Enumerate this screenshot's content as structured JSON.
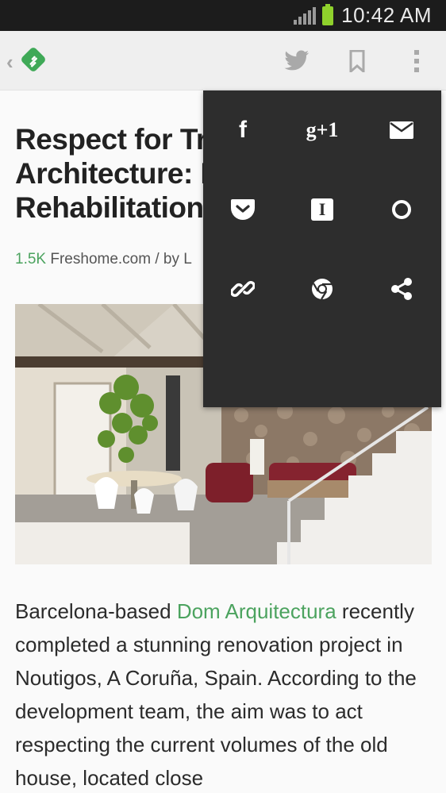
{
  "status_bar": {
    "time": "10:42 AM"
  },
  "toolbar": {
    "back_glyph": "‹",
    "logo_icon": "feedly-logo-icon",
    "actions": [
      "twitter-icon",
      "bookmark-icon",
      "overflow-menu-icon"
    ]
  },
  "article": {
    "title_line1": "Respect for Tra",
    "title_line2": "Architecture: I",
    "title_line3": "Rehabilitation",
    "share_count": "1.5K",
    "source": "Freshome.com / by L",
    "body_intro": "Barcelona-based ",
    "body_link": "Dom Arquitectura",
    "body_rest": " recently completed a stunning renovation project in Noutigos, A Coruña, Spain. According to the development team, the aim was to act respecting the current volumes of the old house, located close"
  },
  "share_menu": {
    "items": [
      {
        "icon": "facebook-icon",
        "glyph": "f"
      },
      {
        "icon": "google-plus-icon",
        "glyph": "g+1"
      },
      {
        "icon": "email-icon",
        "glyph": ""
      },
      {
        "icon": "pocket-icon",
        "glyph": ""
      },
      {
        "icon": "instapaper-icon",
        "glyph": "I"
      },
      {
        "icon": "circle-icon",
        "glyph": ""
      },
      {
        "icon": "link-icon",
        "glyph": ""
      },
      {
        "icon": "chrome-icon",
        "glyph": ""
      },
      {
        "icon": "share-icon",
        "glyph": ""
      }
    ]
  },
  "colors": {
    "accent_green": "#4ca35f",
    "popup_bg": "#2d2d2d",
    "status_bar_bg": "#1c1c1c",
    "toolbar_bg": "#efefef"
  }
}
